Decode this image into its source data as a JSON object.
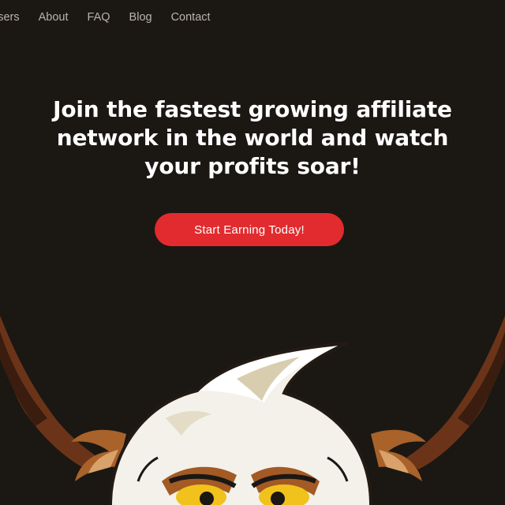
{
  "nav": {
    "items": [
      {
        "label": "isers"
      },
      {
        "label": "About"
      },
      {
        "label": "FAQ"
      },
      {
        "label": "Blog"
      },
      {
        "label": "Contact"
      }
    ]
  },
  "hero": {
    "headline_lines": [
      "Join the fastest growing affiliate",
      "network in the world and watch",
      "your profits soar!"
    ],
    "cta_label": "Start Earning Today!"
  },
  "colors": {
    "background": "#1b1713",
    "accent": "#e22b2e",
    "nav_text": "#b9b3ab",
    "headline": "#ffffff"
  },
  "icons": {
    "mascot": "eagle-mascot-icon"
  }
}
